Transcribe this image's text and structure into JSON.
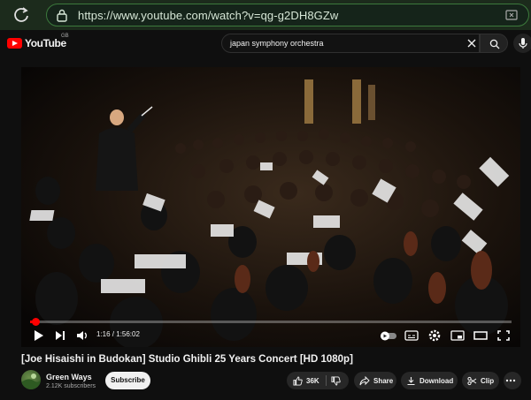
{
  "browser": {
    "url": "https://www.youtube.com/watch?v=qg-g2DH8GZw"
  },
  "header": {
    "logo_text": "YouTube",
    "country_code": "GB",
    "search_query": "japan symphony orchestra"
  },
  "player": {
    "time_display": "1:16 / 1:56:02",
    "progress": 0.011
  },
  "video": {
    "title": "[Joe Hisaishi in Budokan] Studio Ghibli 25 Years Concert [HD 1080p]",
    "channel_name": "Green Ways",
    "subscriber_count": "2.12K subscribers",
    "subscribe_label": "Subscribe",
    "like_count": "36K",
    "share_label": "Share",
    "download_label": "Download",
    "clip_label": "Clip"
  },
  "colors": {
    "accent": "#ff0000",
    "browser_bar": "#1c2b1c",
    "background": "#0f0f0f"
  }
}
